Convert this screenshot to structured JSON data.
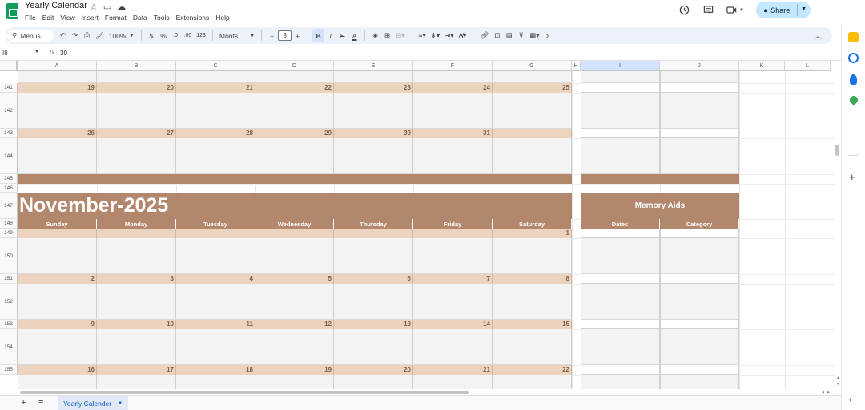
{
  "title_bar": {
    "doc_title": "Yearly Calendar",
    "icons": [
      "star-icon",
      "folder-move-icon",
      "cloud-saved-icon"
    ],
    "share_label": "Share"
  },
  "menu": [
    "File",
    "Edit",
    "View",
    "Insert",
    "Format",
    "Data",
    "Tools",
    "Extensions",
    "Help"
  ],
  "toolbar": {
    "search_label": "Menus",
    "zoom": "100%",
    "currency": "$",
    "percent": "%",
    "decrease_decimal": ".0",
    "increase_decimal": ".00",
    "number_format": "123",
    "font": "Monts...",
    "font_size": "8",
    "bold": "B",
    "italic": "I",
    "strike": "S",
    "text_color": "A"
  },
  "formula_bar": {
    "name_box": "I8",
    "fx": "fx",
    "value": "30"
  },
  "columns": [
    "A",
    "B",
    "C",
    "D",
    "E",
    "F",
    "G",
    "H",
    "I",
    "J",
    "K",
    "L"
  ],
  "selected_column": "I",
  "rows": [
    {
      "n": "141"
    },
    {
      "n": "142"
    },
    {
      "n": "143"
    },
    {
      "n": "144"
    },
    {
      "n": "145"
    },
    {
      "n": "146"
    },
    {
      "n": "147"
    },
    {
      "n": "148"
    },
    {
      "n": "149"
    },
    {
      "n": "150"
    },
    {
      "n": "151"
    },
    {
      "n": "152"
    },
    {
      "n": "153"
    },
    {
      "n": "154"
    },
    {
      "n": "155"
    }
  ],
  "calendar": {
    "month_title": "November-2025",
    "weekdays": [
      "Sunday",
      "Monday",
      "Tuesday",
      "Wednesday",
      "Thursday",
      "Friday",
      "Saturday"
    ],
    "prev_weeks": [
      [
        "19",
        "20",
        "21",
        "22",
        "23",
        "24",
        "25"
      ],
      [
        "26",
        "27",
        "28",
        "29",
        "30",
        "31",
        ""
      ]
    ],
    "weeks": [
      [
        "",
        "",
        "",
        "",
        "",
        "",
        "1"
      ],
      [
        "2",
        "3",
        "4",
        "5",
        "6",
        "7",
        "8"
      ],
      [
        "9",
        "10",
        "11",
        "12",
        "13",
        "14",
        "15"
      ],
      [
        "16",
        "17",
        "18",
        "19",
        "20",
        "21",
        "22"
      ]
    ]
  },
  "memory_aids": {
    "title": "Memory Aids",
    "col_dates": "Dates",
    "col_category": "Category"
  },
  "sheet_tabs": [
    {
      "label": "Yearly Calender",
      "active": true
    }
  ],
  "side_panel": [
    "sheets-icon",
    "keep-icon",
    "tasks-icon",
    "contacts-icon",
    "maps-icon"
  ],
  "colors": {
    "tan": "#b2876c",
    "light_tan": "#ebd3bd",
    "cell_gray": "#f3f3f3",
    "share_bg": "#c2e7ff"
  }
}
